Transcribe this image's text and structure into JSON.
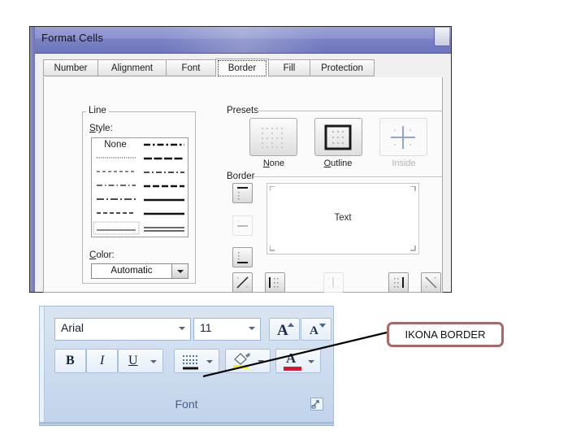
{
  "dialog": {
    "title": "Format Cells",
    "close_icon": "close-icon",
    "tabs": [
      {
        "label": "Number",
        "active": false
      },
      {
        "label": "Alignment",
        "active": false
      },
      {
        "label": "Font",
        "active": false
      },
      {
        "label": "Border",
        "active": true
      },
      {
        "label": "Fill",
        "active": false
      },
      {
        "label": "Protection",
        "active": false
      }
    ],
    "line_group": {
      "title": "Line",
      "style_label": "Style:",
      "none_label": "None",
      "color_label": "Color:",
      "color_value": "Automatic",
      "color_dropdown_icon": "chevron-down-icon",
      "styles_left": [
        "none",
        "dotted-fine",
        "dashed-fine",
        "dash-dot",
        "dash-dot-medium",
        "dashed-medium",
        "hairline-solid"
      ],
      "styles_right": [
        "dash-dot-bold",
        "dashed-bold",
        "dash-dot-thin",
        "dashed-thick",
        "solid-medium",
        "solid-thick",
        "double"
      ]
    },
    "presets": {
      "title": "Presets",
      "items": [
        {
          "label": "None",
          "icon": "preset-none-icon",
          "enabled": true
        },
        {
          "label": "Outline",
          "icon": "preset-outline-icon",
          "enabled": true
        },
        {
          "label": "Inside",
          "icon": "preset-inside-icon",
          "enabled": false
        }
      ]
    },
    "border": {
      "title": "Border",
      "preview_text": "Text",
      "left_buttons": [
        {
          "icon": "border-top-icon",
          "enabled": true
        },
        {
          "icon": "border-middle-horizontal-icon",
          "enabled": false
        },
        {
          "icon": "border-bottom-icon",
          "enabled": true
        }
      ],
      "bottom_buttons": [
        {
          "icon": "border-diagonal-up-icon",
          "enabled": true
        },
        {
          "icon": "border-left-icon",
          "enabled": true
        },
        {
          "icon": "border-middle-vertical-icon",
          "enabled": false
        },
        {
          "icon": "border-right-icon",
          "enabled": true
        },
        {
          "icon": "border-diagonal-down-icon",
          "enabled": true
        }
      ]
    }
  },
  "ribbon": {
    "group_label": "Font",
    "launcher_icon": "dialog-launcher-icon",
    "font_name": "Arial",
    "font_name_arrow_icon": "chevron-down-icon",
    "font_size": "11",
    "font_size_arrow_icon": "chevron-down-icon",
    "grow_font": {
      "label": "A",
      "icon": "grow-font-icon"
    },
    "shrink_font": {
      "label": "A",
      "icon": "shrink-font-icon"
    },
    "bold": {
      "label": "B",
      "icon": "bold-icon"
    },
    "italic": {
      "label": "I",
      "icon": "italic-icon"
    },
    "underline": {
      "label": "U",
      "icon": "underline-icon",
      "arrow_icon": "chevron-down-icon"
    },
    "borders": {
      "icon": "borders-icon",
      "arrow_icon": "chevron-down-icon"
    },
    "fill_color": {
      "icon": "fill-color-icon",
      "arrow_icon": "chevron-down-icon",
      "swatch": "#FFF200"
    },
    "font_color": {
      "label": "A",
      "icon": "font-color-icon",
      "arrow_icon": "chevron-down-icon",
      "swatch": "#E8112D"
    }
  },
  "annotation": {
    "label": "IKONA BORDER",
    "border_color": "#A8686A",
    "leader_color": "#000000"
  }
}
